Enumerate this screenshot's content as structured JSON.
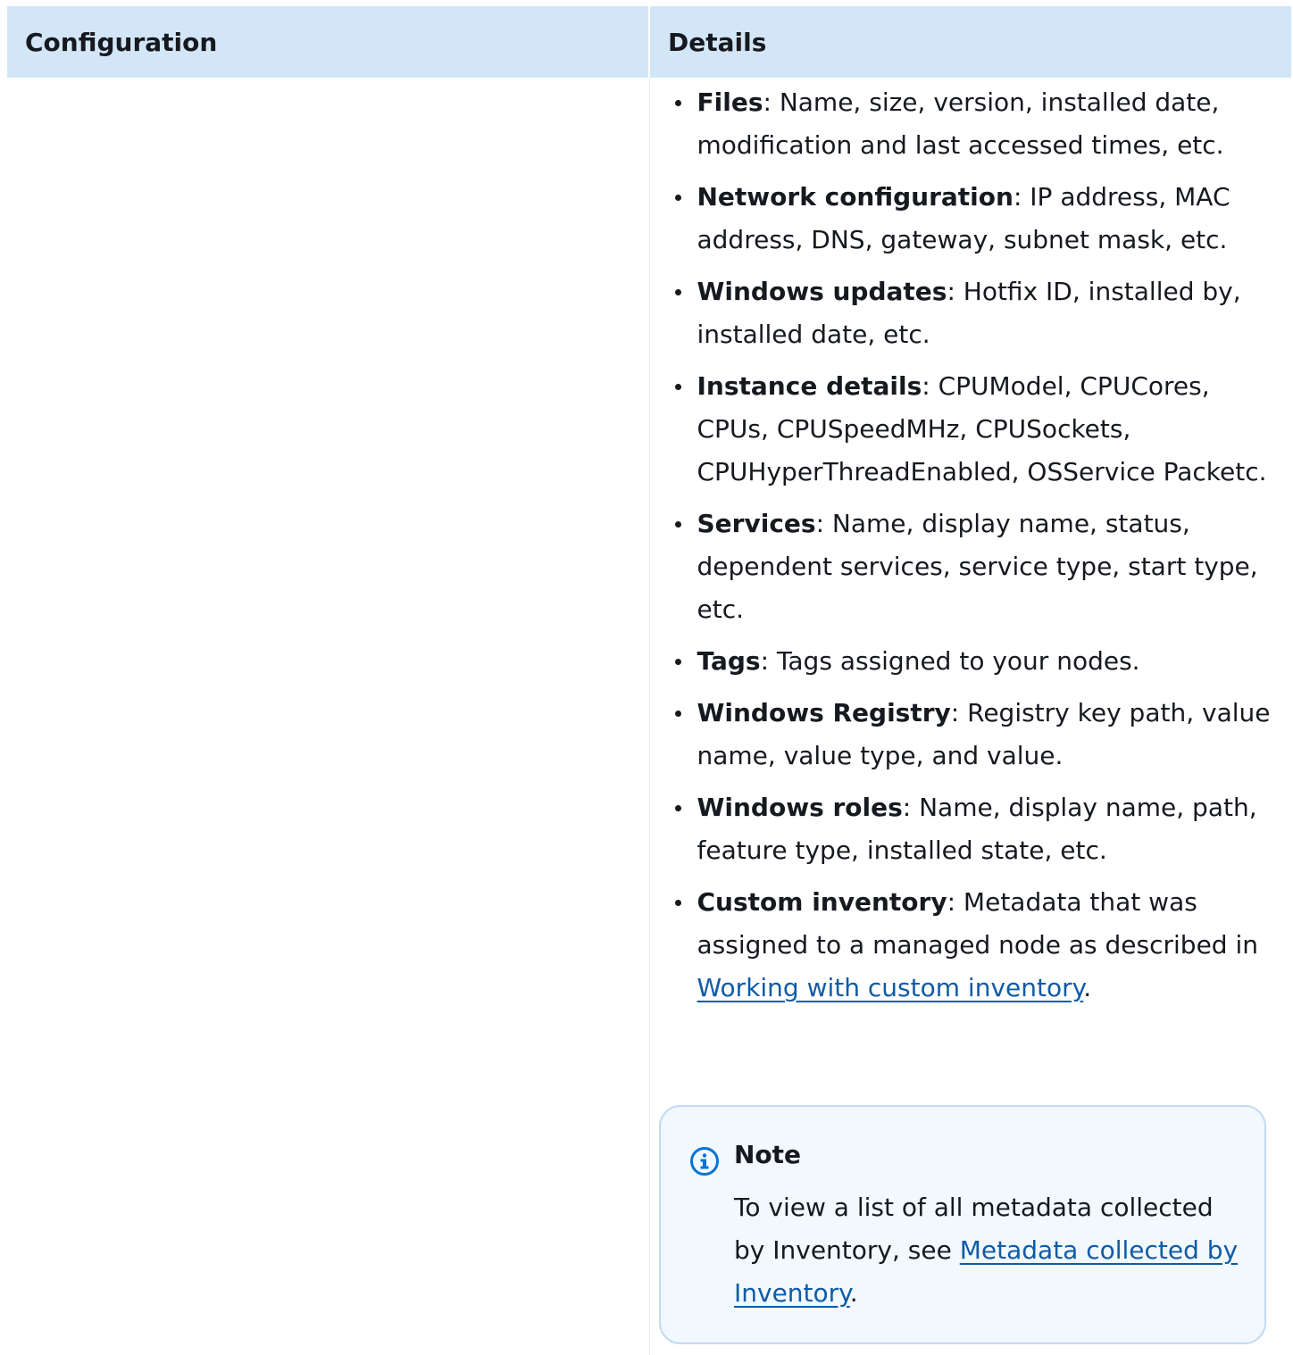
{
  "table": {
    "headers": {
      "configuration": "Configuration",
      "details": "Details"
    },
    "details_items": [
      {
        "term": "Files",
        "text": ": Name, size, version, installed date, modification and last accessed times, etc."
      },
      {
        "term": "Network configuration",
        "text": ": IP address, MAC address, DNS, gateway, subnet mask, etc."
      },
      {
        "term": "Windows updates",
        "text": ": Hotfix ID, installed by, installed date, etc."
      },
      {
        "term": "Instance details",
        "text": ": CPUModel, CPUCores, CPUs, CPUSpeedMHz, CPUSockets, CPUHyperThreadEnabled, OSService Packetc."
      },
      {
        "term": "Services",
        "text": ": Name, display name, status, dependent services, service type, start type, etc."
      },
      {
        "term": "Tags",
        "text": ": Tags assigned to your nodes."
      },
      {
        "term": "Windows Registry",
        "text": ": Registry key path, value name, value type, and value."
      },
      {
        "term": "Windows roles",
        "text": ": Name, display name, path, feature type, installed state, etc."
      }
    ],
    "custom_inventory": {
      "term": "Custom inventory",
      "text": ": Metadata that was assigned to a managed node as described in ",
      "link": "Working with custom inventory",
      "suffix": "."
    }
  },
  "note": {
    "title": "Note",
    "text": "To view a list of all metadata collected by Inventory, see ",
    "link": "Metadata collected by Inventory",
    "suffix": ".",
    "icon": "info-icon",
    "icon_color": "#0972d3"
  },
  "colors": {
    "header_bg": "#d3e6f8",
    "link": "#0f5ba7",
    "note_bg": "#f1f8fe",
    "note_border": "#c2dbf3"
  }
}
